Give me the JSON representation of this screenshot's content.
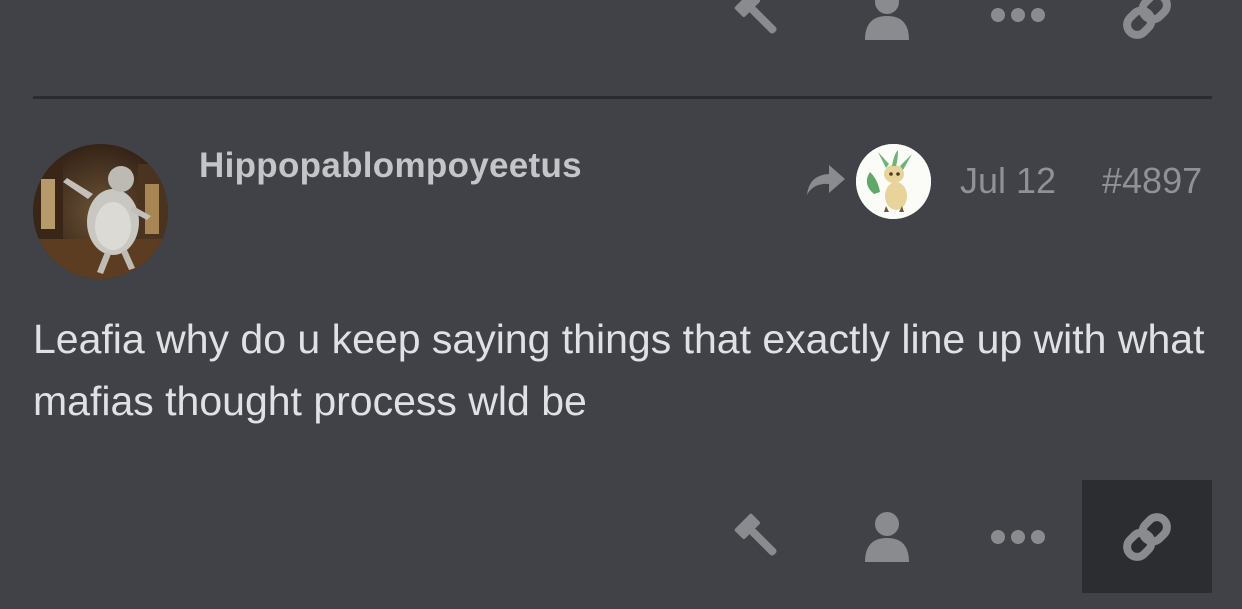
{
  "post": {
    "username": "Hippopablompoyeetus",
    "date": "Jul 12",
    "number": "#4897",
    "body": "Leafia why do u keep saying things that exactly line up with what mafias thought process wld be"
  },
  "actions": {
    "top": [
      "gavel-icon",
      "user-icon",
      "more-icon",
      "link-icon"
    ],
    "bottom": [
      "gavel-icon",
      "user-icon",
      "more-icon",
      "link-icon"
    ],
    "active_bottom": "link-icon"
  },
  "colors": {
    "background": "#404247",
    "icon": "#8a8b8f",
    "text": "#e0e1e4",
    "username": "#c4c5c9",
    "meta": "#909196",
    "divider": "#2a2b2e",
    "active_button": "#2c2d30"
  }
}
